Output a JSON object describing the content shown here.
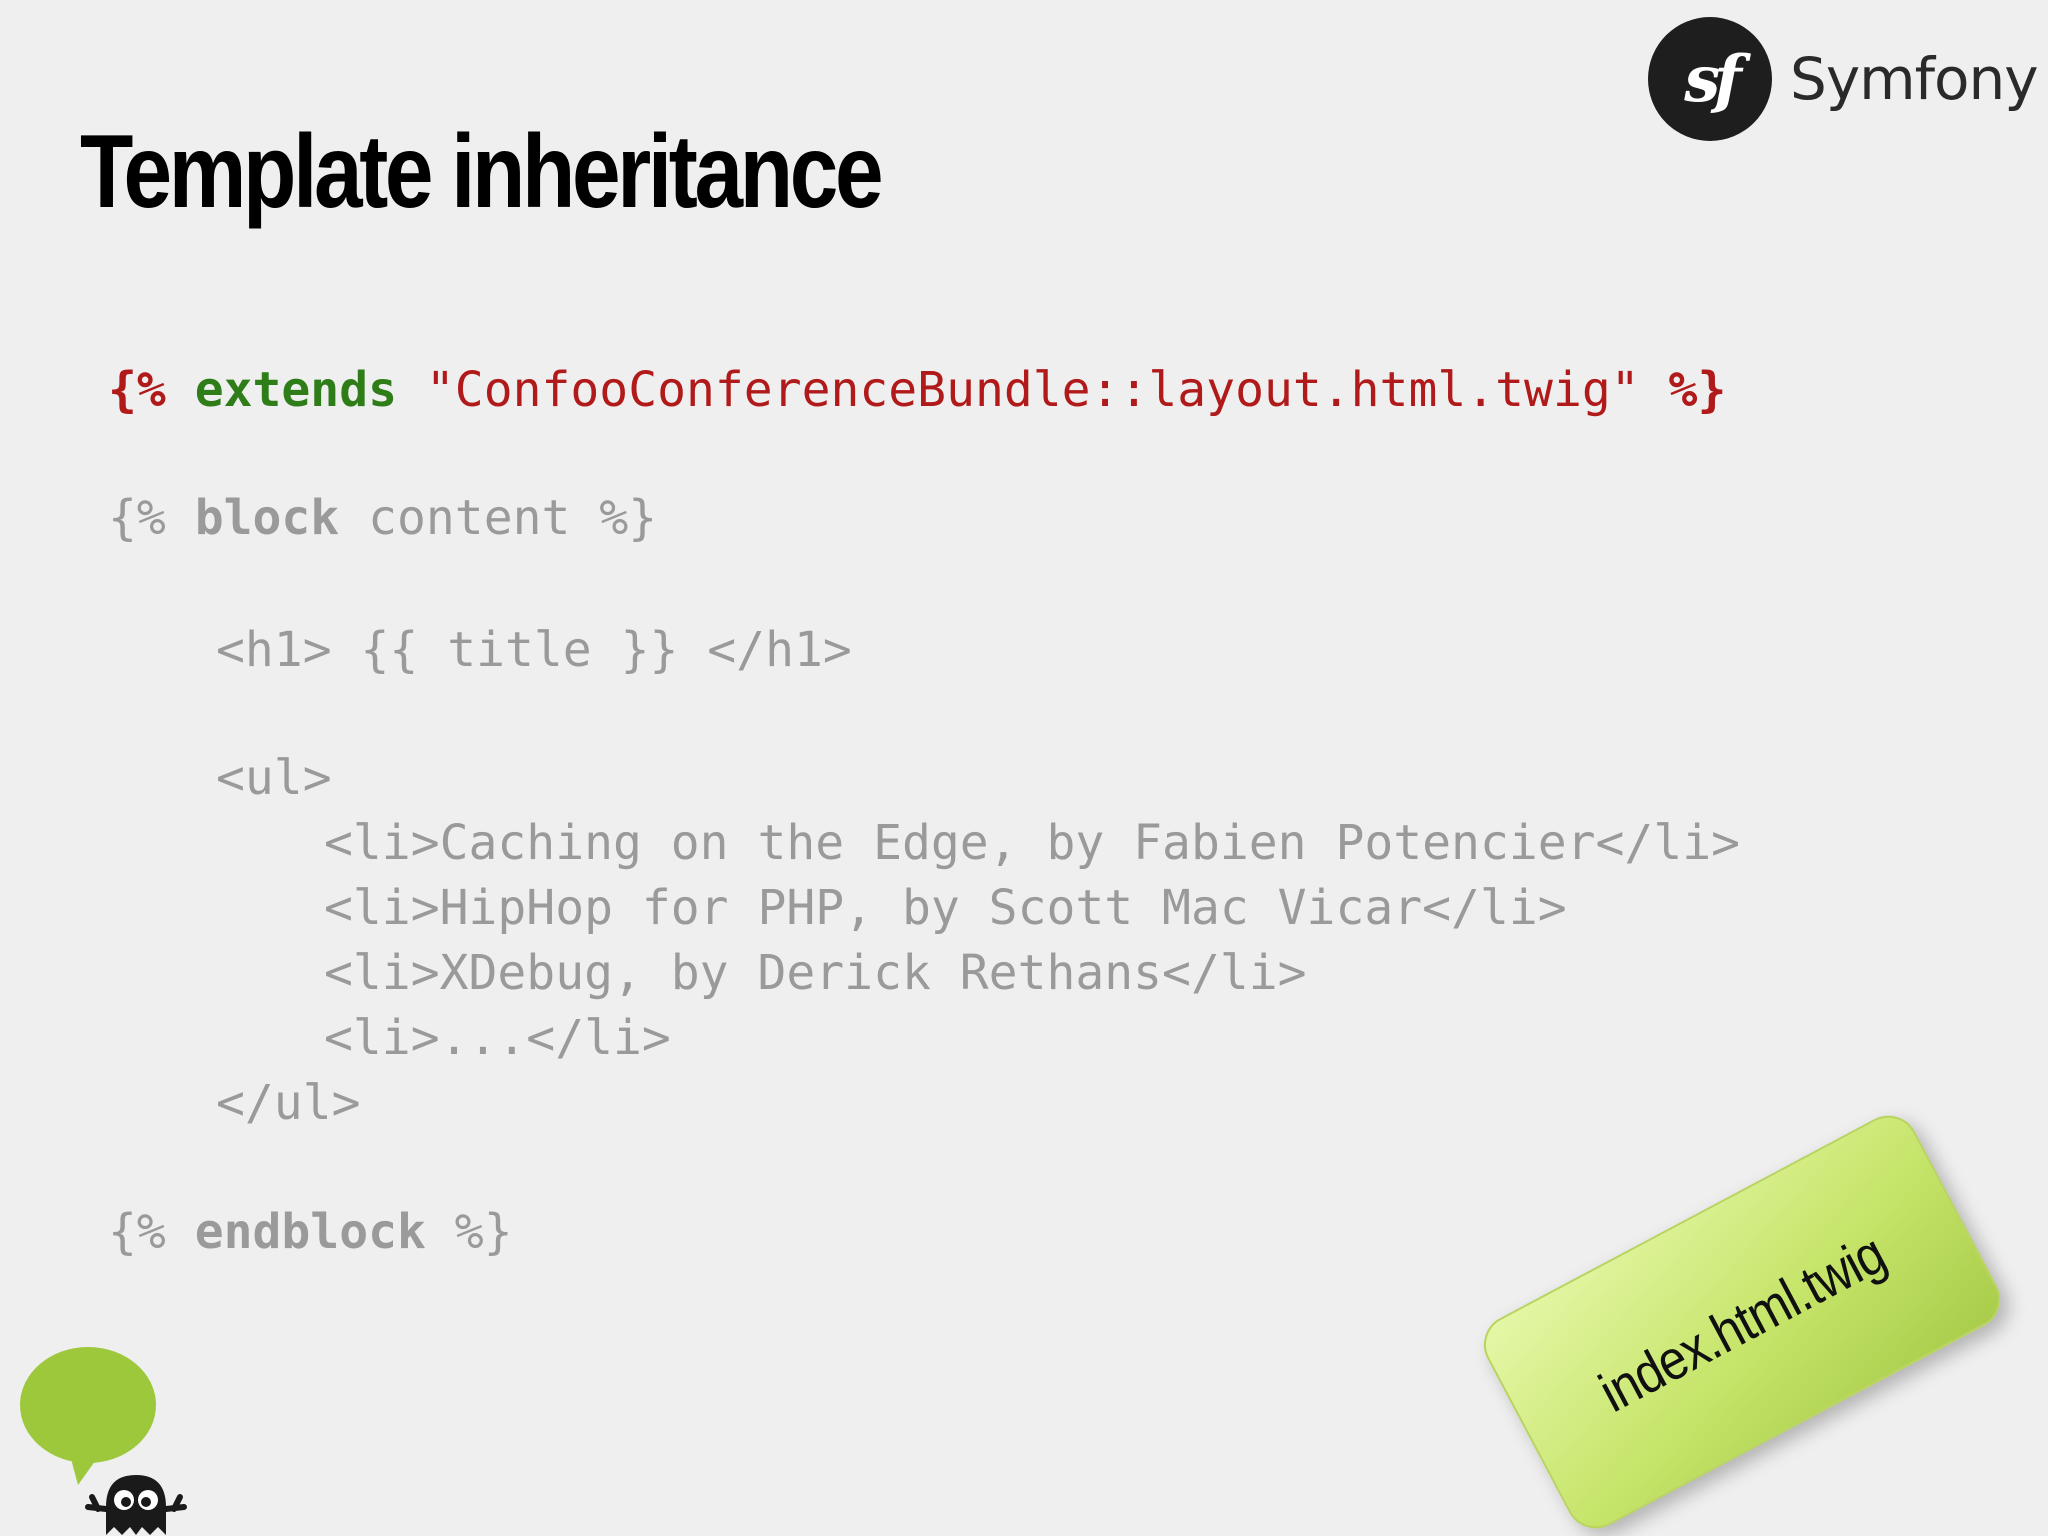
{
  "slide": {
    "title": "Template inheritance",
    "logo": {
      "mark": "sf",
      "wordmark": "Symfony",
      "icon": "symfony-logo-icon"
    },
    "code": {
      "line1": {
        "open": "{%",
        "keyword": "extends",
        "string": "\"ConfooConferenceBundle::layout.html.twig\"",
        "close": "%}"
      },
      "line2": {
        "open": "{%",
        "keyword": "block",
        "name": "content",
        "close": "%}"
      },
      "line3": "<h1> {{ title }} </h1>",
      "line4": "<ul>",
      "line5": "<li>Caching on the Edge, by Fabien Potencier</li>",
      "line6": "<li>HipHop for PHP, by Scott Mac Vicar</li>",
      "line7": "<li>XDebug, by Derick Rethans</li>",
      "line8": "<li>...</li>",
      "line9": "</ul>",
      "line10": {
        "open": "{%",
        "keyword": "endblock",
        "close": "%}"
      }
    },
    "sticky_note": {
      "label": "index.html.twig",
      "color": "#c6e56a"
    },
    "mascot": {
      "icon": "speech-bubble-mascot-icon",
      "bubble_color": "#9dc83c"
    }
  }
}
